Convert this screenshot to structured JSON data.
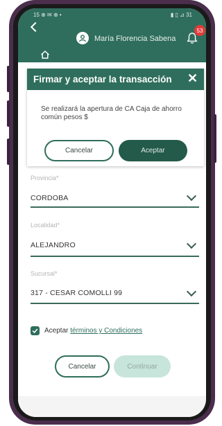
{
  "status_bar": {
    "left": "15 ⊕ ✉ ⊕ •",
    "right": "▮ ▯ ⊿ 31"
  },
  "header": {
    "user_name": "María Florencia Sabena",
    "notifications_count": "53"
  },
  "form": {
    "provincia": {
      "label": "Provincia*",
      "value": "CORDOBA"
    },
    "localidad": {
      "label": "Localidad*",
      "value": "ALEJANDRO"
    },
    "sucursal": {
      "label": "Sucursal*",
      "value": "317 - CESAR COMOLLI 99"
    },
    "terms": {
      "prefix": "Aceptar ",
      "link": "términos y Condiciones"
    },
    "cancel_label": "Cancelar",
    "continue_label": "Continuar"
  },
  "modal": {
    "title": "Firmar y aceptar la transacción",
    "close": "✕",
    "body": "Se realizará la apertura de CA Caja de ahorro común pesos $",
    "cancel_label": "Cancelar",
    "accept_label": "Aceptar"
  },
  "colors": {
    "primary": "#2f6e5c",
    "dark_accent": "#235a4a",
    "badge": "#e23b3b",
    "frame": "#4a2e4c"
  }
}
